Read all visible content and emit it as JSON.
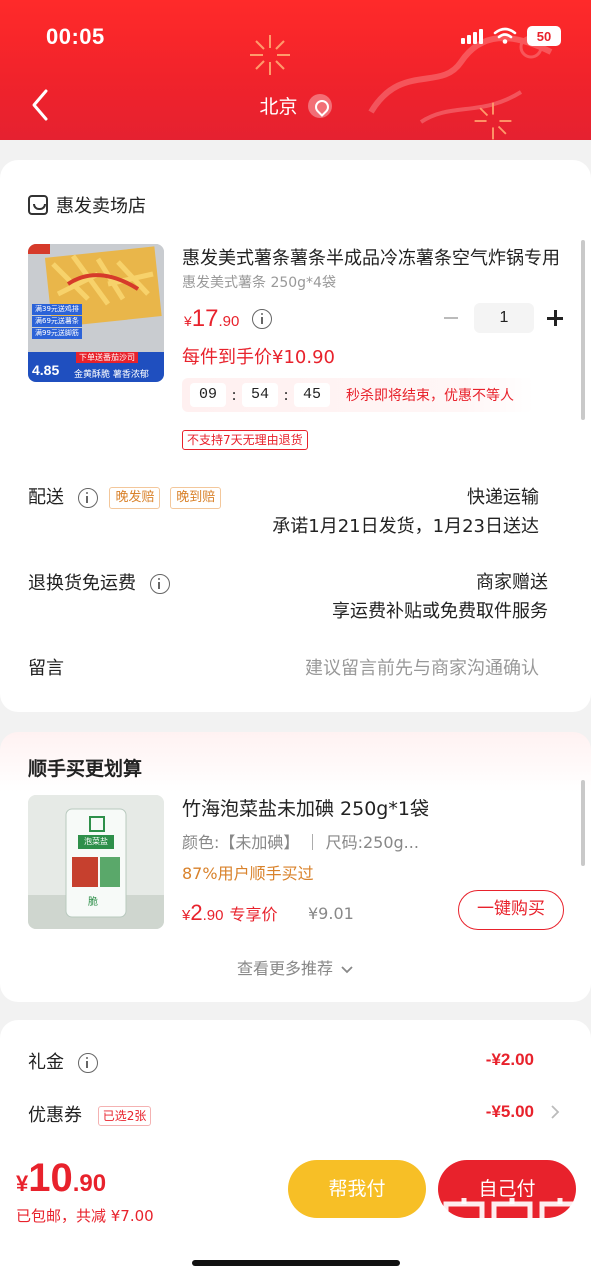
{
  "status_bar": {
    "time": "00:05",
    "battery": "50"
  },
  "header": {
    "city": "北京"
  },
  "shop": {
    "name": "惠发卖场店"
  },
  "product": {
    "title": "惠发美式薯条薯条半成品冷冻薯条空气炸锅专用",
    "spec": "惠发美式薯条 250g*4袋",
    "price_yen": "¥",
    "price_int": "17",
    "price_dec": ".90",
    "quantity": "1",
    "final_price": "每件到手价¥10.90",
    "countdown": {
      "h": "09",
      "m": "54",
      "s": "45",
      "text": "秒杀即将结束，优惠不等人"
    },
    "no_return": "不支持7天无理由退货",
    "image_lines": [
      "满39元送鸡排",
      "满69元送薯条",
      "满99元送脚筋",
      "下单送番茄沙司",
      "金黄酥脆 薯香浓郁"
    ],
    "image_badge": "4.85"
  },
  "delivery": {
    "label": "配送",
    "tags": [
      "晚发赔",
      "晚到赔"
    ],
    "method": "快递运输",
    "promise": "承诺1月21日发货，1月23日送达"
  },
  "return_shipping": {
    "label": "退换货免运费",
    "value": "商家赠送",
    "desc": "享运费补贴或免费取件服务"
  },
  "message": {
    "label": "留言",
    "placeholder": "建议留言前先与商家沟通确认"
  },
  "recommend": {
    "title": "顺手买更划算",
    "item_title": "竹海泡菜盐未加碘 250g*1袋",
    "item_spec": "颜色:【未加碘】  ｜ 尺码:250g...",
    "item_pct": "87%用户顺手买过",
    "price_yen": "¥",
    "price_int": "2",
    "price_dec": ".90",
    "price_tag": "专享价",
    "orig_price": "¥9.01",
    "buy_label": "一键购买",
    "see_more": "查看更多推荐",
    "image_label": "泡菜盐",
    "image_sub": "脆"
  },
  "discounts": {
    "gift": {
      "label": "礼金",
      "amount": "-¥2.00"
    },
    "coupon": {
      "label": "优惠券",
      "tag": "已选2张",
      "amount": "-¥5.00"
    }
  },
  "bottom": {
    "total_yen": "¥",
    "total_int": "10",
    "total_dec": ".90",
    "sub": "已包邮，共减 ¥7.00",
    "help_label": "帮我付",
    "self_label": "自己付",
    "watermark": "zhizhizhi.com"
  },
  "colors": {
    "accent": "#e8222c",
    "yellow": "#f7bf26",
    "orange": "#d9822b"
  }
}
